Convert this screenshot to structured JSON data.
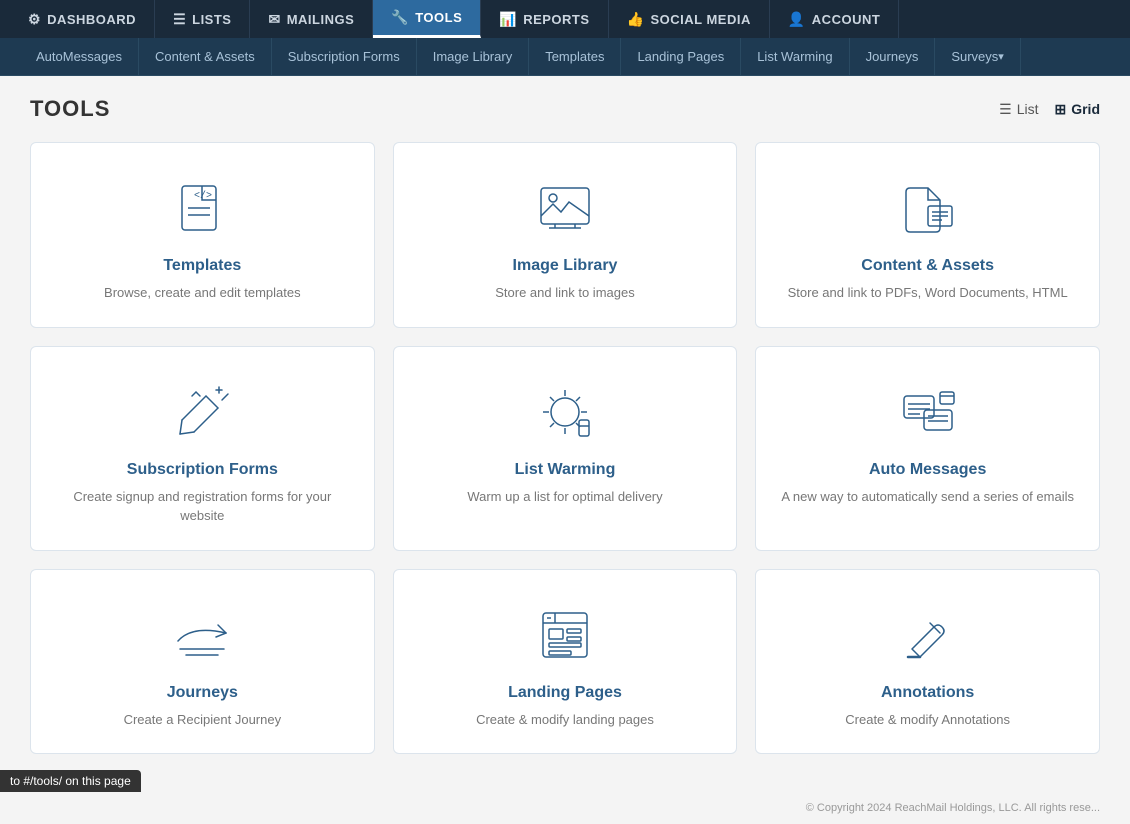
{
  "topNav": {
    "items": [
      {
        "id": "dashboard",
        "label": "DASHBOARD",
        "icon": "⚙",
        "active": false
      },
      {
        "id": "lists",
        "label": "LISTS",
        "icon": "☰",
        "active": false
      },
      {
        "id": "mailings",
        "label": "MAILINGS",
        "icon": "✉",
        "active": false
      },
      {
        "id": "tools",
        "label": "TOOLS",
        "icon": "🔧",
        "active": true
      },
      {
        "id": "reports",
        "label": "REPORTS",
        "icon": "📊",
        "active": false
      },
      {
        "id": "social-media",
        "label": "SOCIAL MEDIA",
        "icon": "👍",
        "active": false
      },
      {
        "id": "account",
        "label": "ACCOUNT",
        "icon": "👤",
        "active": false
      }
    ]
  },
  "subNav": {
    "items": [
      {
        "id": "auto-messages",
        "label": "AutoMessages",
        "hasArrow": false
      },
      {
        "id": "content-assets",
        "label": "Content & Assets",
        "hasArrow": false
      },
      {
        "id": "subscription-forms",
        "label": "Subscription Forms",
        "hasArrow": false
      },
      {
        "id": "image-library",
        "label": "Image Library",
        "hasArrow": false
      },
      {
        "id": "templates",
        "label": "Templates",
        "hasArrow": false
      },
      {
        "id": "landing-pages",
        "label": "Landing Pages",
        "hasArrow": false
      },
      {
        "id": "list-warming",
        "label": "List Warming",
        "hasArrow": false
      },
      {
        "id": "journeys",
        "label": "Journeys",
        "hasArrow": false
      },
      {
        "id": "surveys",
        "label": "Surveys",
        "hasArrow": true
      }
    ]
  },
  "page": {
    "title": "TOOLS",
    "viewToggle": {
      "list": "List",
      "grid": "Grid",
      "active": "grid"
    }
  },
  "tools": [
    {
      "id": "templates",
      "title": "Templates",
      "description": "Browse, create and edit templates",
      "iconType": "templates"
    },
    {
      "id": "image-library",
      "title": "Image Library",
      "description": "Store and link to images",
      "iconType": "image-library"
    },
    {
      "id": "content-assets",
      "title": "Content & Assets",
      "description": "Store and link to PDFs, Word Documents, HTML",
      "iconType": "content-assets"
    },
    {
      "id": "subscription-forms",
      "title": "Subscription Forms",
      "description": "Create signup and registration forms for your website",
      "iconType": "subscription-forms"
    },
    {
      "id": "list-warming",
      "title": "List Warming",
      "description": "Warm up a list for optimal delivery",
      "iconType": "list-warming"
    },
    {
      "id": "auto-messages",
      "title": "Auto Messages",
      "description": "A new way to automatically send a series of emails",
      "iconType": "auto-messages"
    },
    {
      "id": "journeys",
      "title": "Journeys",
      "description": "Create a Recipient Journey",
      "iconType": "journeys"
    },
    {
      "id": "landing-pages",
      "title": "Landing Pages",
      "description": "Create & modify landing pages",
      "iconType": "landing-pages"
    },
    {
      "id": "annotations",
      "title": "Annotations",
      "description": "Create & modify Annotations",
      "iconType": "annotations"
    }
  ],
  "footer": {
    "copyright": "© Copyright 2024 ReachMail Holdings, LLC. All rights rese..."
  },
  "statusBar": {
    "text": "to #/tools/ on this page"
  }
}
